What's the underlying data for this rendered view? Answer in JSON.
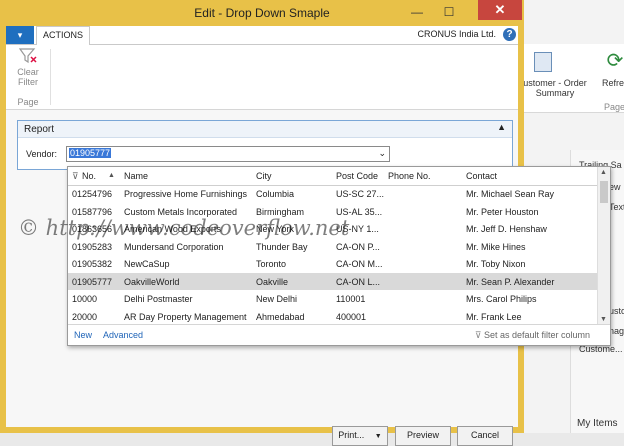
{
  "window": {
    "title": "Edit - Drop Down Smaple",
    "minimize_glyph": "—",
    "maximize_glyph": "☐",
    "close_glyph": "✕"
  },
  "tabs": {
    "menu_glyph": "▾",
    "actions_label": "ACTIONS",
    "company": "CRONUS India Ltd.",
    "help_glyph": "?"
  },
  "ribbon": {
    "clear_filter_line1": "Clear",
    "clear_filter_line2": "Filter",
    "group_label": "Page"
  },
  "report": {
    "title": "Report",
    "collapse_glyph": "▲",
    "vendor_label": "Vendor:",
    "vendor_value": "01905777",
    "dropdown_glyph": "⌄"
  },
  "lookup": {
    "columns": {
      "filter_glyph": "⊽",
      "no": "No.",
      "sort_glyph": "▲",
      "name": "Name",
      "city": "City",
      "post_code": "Post Code",
      "phone": "Phone No.",
      "contact": "Contact"
    },
    "rows": [
      {
        "no": "01254796",
        "name": "Progressive Home Furnishings",
        "city": "Columbia",
        "post_code": "US-SC 27...",
        "phone": "",
        "contact": "Mr. Michael Sean Ray"
      },
      {
        "no": "01587796",
        "name": "Custom Metals Incorporated",
        "city": "Birmingham",
        "post_code": "US-AL 35...",
        "phone": "",
        "contact": "Mr. Peter Houston"
      },
      {
        "no": "01863656",
        "name": "American Wood Exports",
        "city": "New York",
        "post_code": "US-NY 1...",
        "phone": "",
        "contact": "Mr. Jeff D. Henshaw"
      },
      {
        "no": "01905283",
        "name": "Mundersand Corporation",
        "city": "Thunder Bay",
        "post_code": "CA-ON P...",
        "phone": "",
        "contact": "Mr. Mike Hines"
      },
      {
        "no": "01905382",
        "name": "NewCaSup",
        "city": "Toronto",
        "post_code": "CA-ON M...",
        "phone": "",
        "contact": "Mr. Toby Nixon"
      },
      {
        "no": "01905777",
        "name": "OakvilleWorld",
        "city": "Oakville",
        "post_code": "CA-ON L...",
        "phone": "",
        "contact": "Mr. Sean P. Alexander"
      },
      {
        "no": "10000",
        "name": "Delhi Postmaster",
        "city": "New Delhi",
        "post_code": "110001",
        "phone": "",
        "contact": "Mrs. Carol Philips"
      },
      {
        "no": "20000",
        "name": "AR Day Property Management",
        "city": "Ahmedabad",
        "post_code": "400001",
        "phone": "",
        "contact": "Mr. Frank Lee"
      }
    ],
    "selected_index": 5,
    "footer": {
      "new_label": "New",
      "advanced_label": "Advanced",
      "default_filter_label": "Set as default filter column"
    }
  },
  "buttons": {
    "print_label": "Print...",
    "preview_label": "Preview",
    "cancel_label": "Cancel"
  },
  "background": {
    "summary_line1": "ustomer - Order",
    "summary_line2": "Summary",
    "refresh_label": "Refre",
    "page_label": "Page",
    "trailing_label": "Trailing Sa",
    "new_short": "ew",
    "text_short": "Text",
    "customer_short": "usto",
    "manage_short": "nag",
    "customer_link": "Custome...",
    "my_items": "My Items"
  },
  "watermark": "© http://www.codeoverflow.net",
  "colors": {
    "title_bar": "#e8c148",
    "close": "#c7463e",
    "accent": "#1f6fbf",
    "selection": "#d9d9d9"
  }
}
